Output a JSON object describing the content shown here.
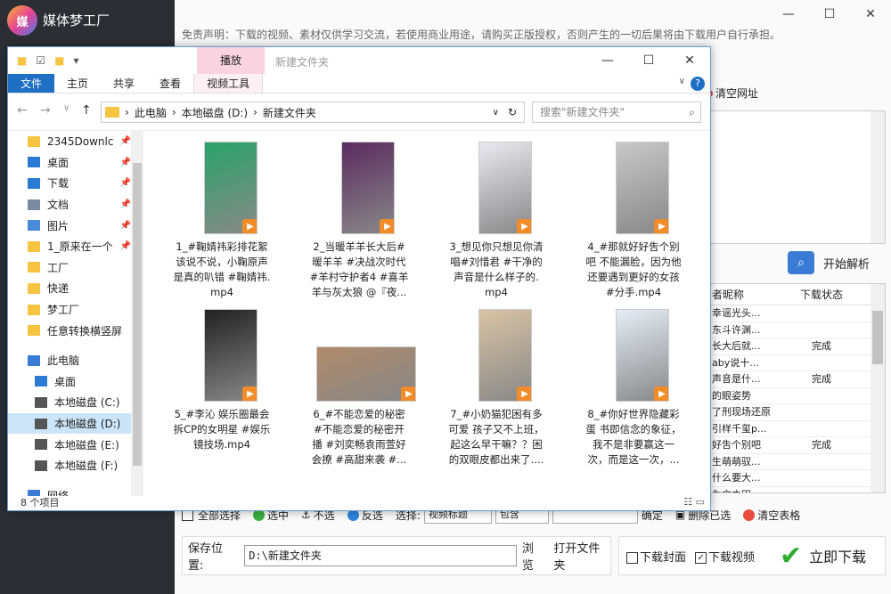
{
  "app": {
    "logo_text": "媒",
    "title": "媒体梦工厂",
    "disclaimer": "免责声明：下载的视频、素材仅供学习交流，若使用商业用途，请购买正版授权，否则产生的一切后果将由下载用户自行承担。",
    "clear_url": "清空网址",
    "parse_btn": "开始解析",
    "results": {
      "col_name": "者昵称",
      "col_status": "下载状态",
      "rows": [
        {
          "name": "幸谣光头...",
          "status": ""
        },
        {
          "name": "东斗许渊...",
          "status": ""
        },
        {
          "name": "长大后就...",
          "status": "完成"
        },
        {
          "name": "aby说十...",
          "status": ""
        },
        {
          "name": "声音是什...",
          "status": "完成"
        },
        {
          "name": "的眼姿势",
          "status": ""
        },
        {
          "name": "了刑现场还原",
          "status": ""
        },
        {
          "name": "引样千玺p...",
          "status": ""
        },
        {
          "name": "好吿个别吧",
          "status": "完成"
        },
        {
          "name": "生萌萌驭...",
          "status": ""
        },
        {
          "name": "什么要大...",
          "status": ""
        },
        {
          "name": "为文之田",
          "status": ""
        }
      ]
    },
    "toolbar": {
      "select_all": "全部选择",
      "select": "选中",
      "unselect": "不选",
      "invert": "反选",
      "choose": "选择:",
      "field": "视频标题",
      "mode": "包含",
      "confirm": "确定",
      "delete_selected": "删除已选",
      "clear_table": "清空表格"
    },
    "save": {
      "label": "保存位置:",
      "path": "D:\\新建文件夹",
      "browse": "浏览",
      "open_folder": "打开文件夹"
    },
    "download": {
      "cover": "下载封面",
      "video": "下载视频",
      "now": "立即下载"
    },
    "window": {
      "min": "—",
      "max": "☐",
      "close": "✕"
    }
  },
  "explorer": {
    "title": "新建文件夹",
    "context_tab": "播放",
    "ribbon_tabs": [
      "文件",
      "主页",
      "共享",
      "查看",
      "视频工具"
    ],
    "address": [
      "此电脑",
      "本地磁盘 (D:)",
      "新建文件夹"
    ],
    "search_placeholder": "搜索\"新建文件夹\"",
    "nav": [
      {
        "label": "2345Downlc",
        "icon": "folder-icon",
        "pin": true
      },
      {
        "label": "桌面",
        "icon": "desktop-icon",
        "pin": true
      },
      {
        "label": "下载",
        "icon": "download-icon",
        "pin": true
      },
      {
        "label": "文档",
        "icon": "document-icon",
        "pin": true
      },
      {
        "label": "图片",
        "icon": "picture-icon",
        "pin": true
      },
      {
        "label": "1_原来在一个",
        "icon": "folder-icon",
        "pin": true
      },
      {
        "label": "工厂",
        "icon": "folder-icon",
        "pin": false
      },
      {
        "label": "快递",
        "icon": "folder-icon",
        "pin": false
      },
      {
        "label": "梦工厂",
        "icon": "folder-icon",
        "pin": false
      },
      {
        "label": "任意转换横竖屏",
        "icon": "folder-icon",
        "pin": false
      },
      {
        "label": "",
        "icon": "",
        "pin": false
      },
      {
        "label": "此电脑",
        "icon": "computer-icon",
        "pin": false
      },
      {
        "label": "桌面",
        "icon": "desktop-icon",
        "pin": false
      },
      {
        "label": "本地磁盘 (C:)",
        "icon": "drive-icon",
        "pin": false
      },
      {
        "label": "本地磁盘 (D:)",
        "icon": "drive-icon",
        "pin": false,
        "selected": true
      },
      {
        "label": "本地磁盘 (E:)",
        "icon": "drive-icon",
        "pin": false
      },
      {
        "label": "本地磁盘 (F:)",
        "icon": "drive-icon",
        "pin": false
      },
      {
        "label": "",
        "icon": "",
        "pin": false
      },
      {
        "label": "网络",
        "icon": "network-icon",
        "pin": false
      }
    ],
    "files": [
      {
        "name": "1_#鞠婧祎彩排花絮 该说不说，小鞠原声 是真的叭错 #鞠婧祎.mp4",
        "lines": [
          "1_#鞠婧祎彩排花絮",
          "该说不说，小鞠原声",
          "是真的叭错 #鞠婧祎.",
          "mp4"
        ],
        "color": "#2aa36b"
      },
      {
        "name": "2_当暖羊羊长大后# 暖羊羊 #决战次时代 #羊村守护者4 #喜羊羊与灰太狼 @『夜...",
        "lines": [
          "2_当暖羊羊长大后#",
          "暖羊羊 #决战次时代",
          "#羊村守护者4 #喜羊",
          "羊与灰太狼 @『夜..."
        ],
        "color": "#5b2c5f"
      },
      {
        "name": "3_想见你只想见你清唱#刘惜君 #干净的声音是什么样子的.mp4",
        "lines": [
          "3_想见你只想见你清",
          "唱#刘惜君 #干净的",
          "声音是什么样子的.",
          "mp4"
        ],
        "color": "#e9e9ef"
      },
      {
        "name": "4_#那就好好吿个别吧 不能漏脸，因为他还要遇到更好的女孩 #分手.mp4",
        "lines": [
          "4_#那就好好吿个别",
          "吧 不能漏脸，因为他",
          "还要遇到更好的女孩",
          "#分手.mp4"
        ],
        "color": "#c8c8c8"
      },
      {
        "name": "5_#李沁 娱乐圈最会拆CP的女明星 #娱乐镜技场.mp4",
        "lines": [
          "5_#李沁 娱乐圈最会",
          "拆CP的女明星 #娱乐",
          "镜技场.mp4"
        ],
        "color": "#222222"
      },
      {
        "name": "6_#不能恋爱的秘密 #不能恋爱的秘密开播 #刘奕畅袁雨萱好会撩 #高甜来袭 #...",
        "lines": [
          "6_#不能恋爱的秘密",
          "#不能恋爱的秘密开",
          "播 #刘奕畅袁雨萱好",
          "会撩 #高甜来袭 #..."
        ],
        "color": "#b08a6a"
      },
      {
        "name": "7_#小奶猫犯困有多可爱 孩子又不上班，起这么早干嘛？？困的双眼皮都出来了....",
        "lines": [
          "7_#小奶猫犯困有多",
          "可爱 孩子又不上班，",
          "起这么早干嘛？？困",
          "的双眼皮都出来了...."
        ],
        "color": "#d8c3a5"
      },
      {
        "name": "8_#你好世界隐藏彩蛋 书即信念的象征，我不是非要赢这一次，而是这一次，...",
        "lines": [
          "8_#你好世界隐藏彩",
          "蛋 书即信念的象征，",
          "我不是非要赢这一",
          "次，而是这一次，..."
        ],
        "color": "#e6edf5"
      }
    ],
    "status": "8 个项目"
  }
}
